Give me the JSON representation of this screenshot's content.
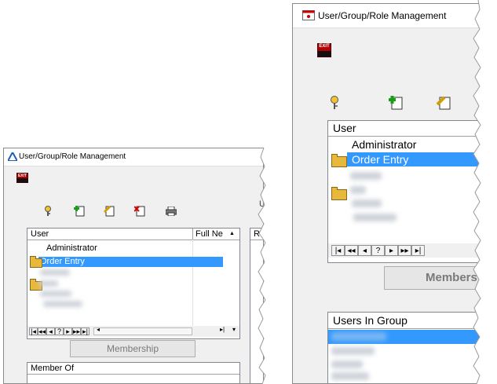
{
  "left_window": {
    "title": "User/Group/Role Management",
    "toolbar": {
      "exit_label": "EXIT",
      "icons": [
        "key-icon",
        "add-icon",
        "edit-icon",
        "delete-icon",
        "print-icon"
      ]
    },
    "user_list": {
      "headers": [
        "User",
        "Full Ne"
      ],
      "rows": [
        "Administrator",
        "Order Entry"
      ]
    },
    "nav_buttons": [
      "|◂",
      "◂◂",
      "◂",
      "?",
      "▸",
      "▸▸",
      "▸|"
    ],
    "membership_button": "Membership",
    "member_of_header": "Member Of",
    "right_partial_header": "U",
    "right_list_header": "R"
  },
  "right_window": {
    "title": "User/Group/Role Management",
    "toolbar": {
      "exit_label": "EXIT",
      "icons": [
        "key-icon",
        "add-icon",
        "edit-icon"
      ]
    },
    "user_list": {
      "header": "User",
      "rows": [
        "Administrator",
        "Order Entry"
      ]
    },
    "nav_buttons": [
      "|◂",
      "◂◂",
      "◂",
      "?",
      "▸",
      "▸▸",
      "▸|"
    ],
    "membership_button": "Members",
    "users_in_group_header": "Users In Group"
  },
  "colors": {
    "selection": "#3399ff",
    "panel_bg": "#f0f0f0",
    "title_triangle": "#1f5fbf",
    "exit_red": "#b00000",
    "folder": "#e8b83a"
  }
}
